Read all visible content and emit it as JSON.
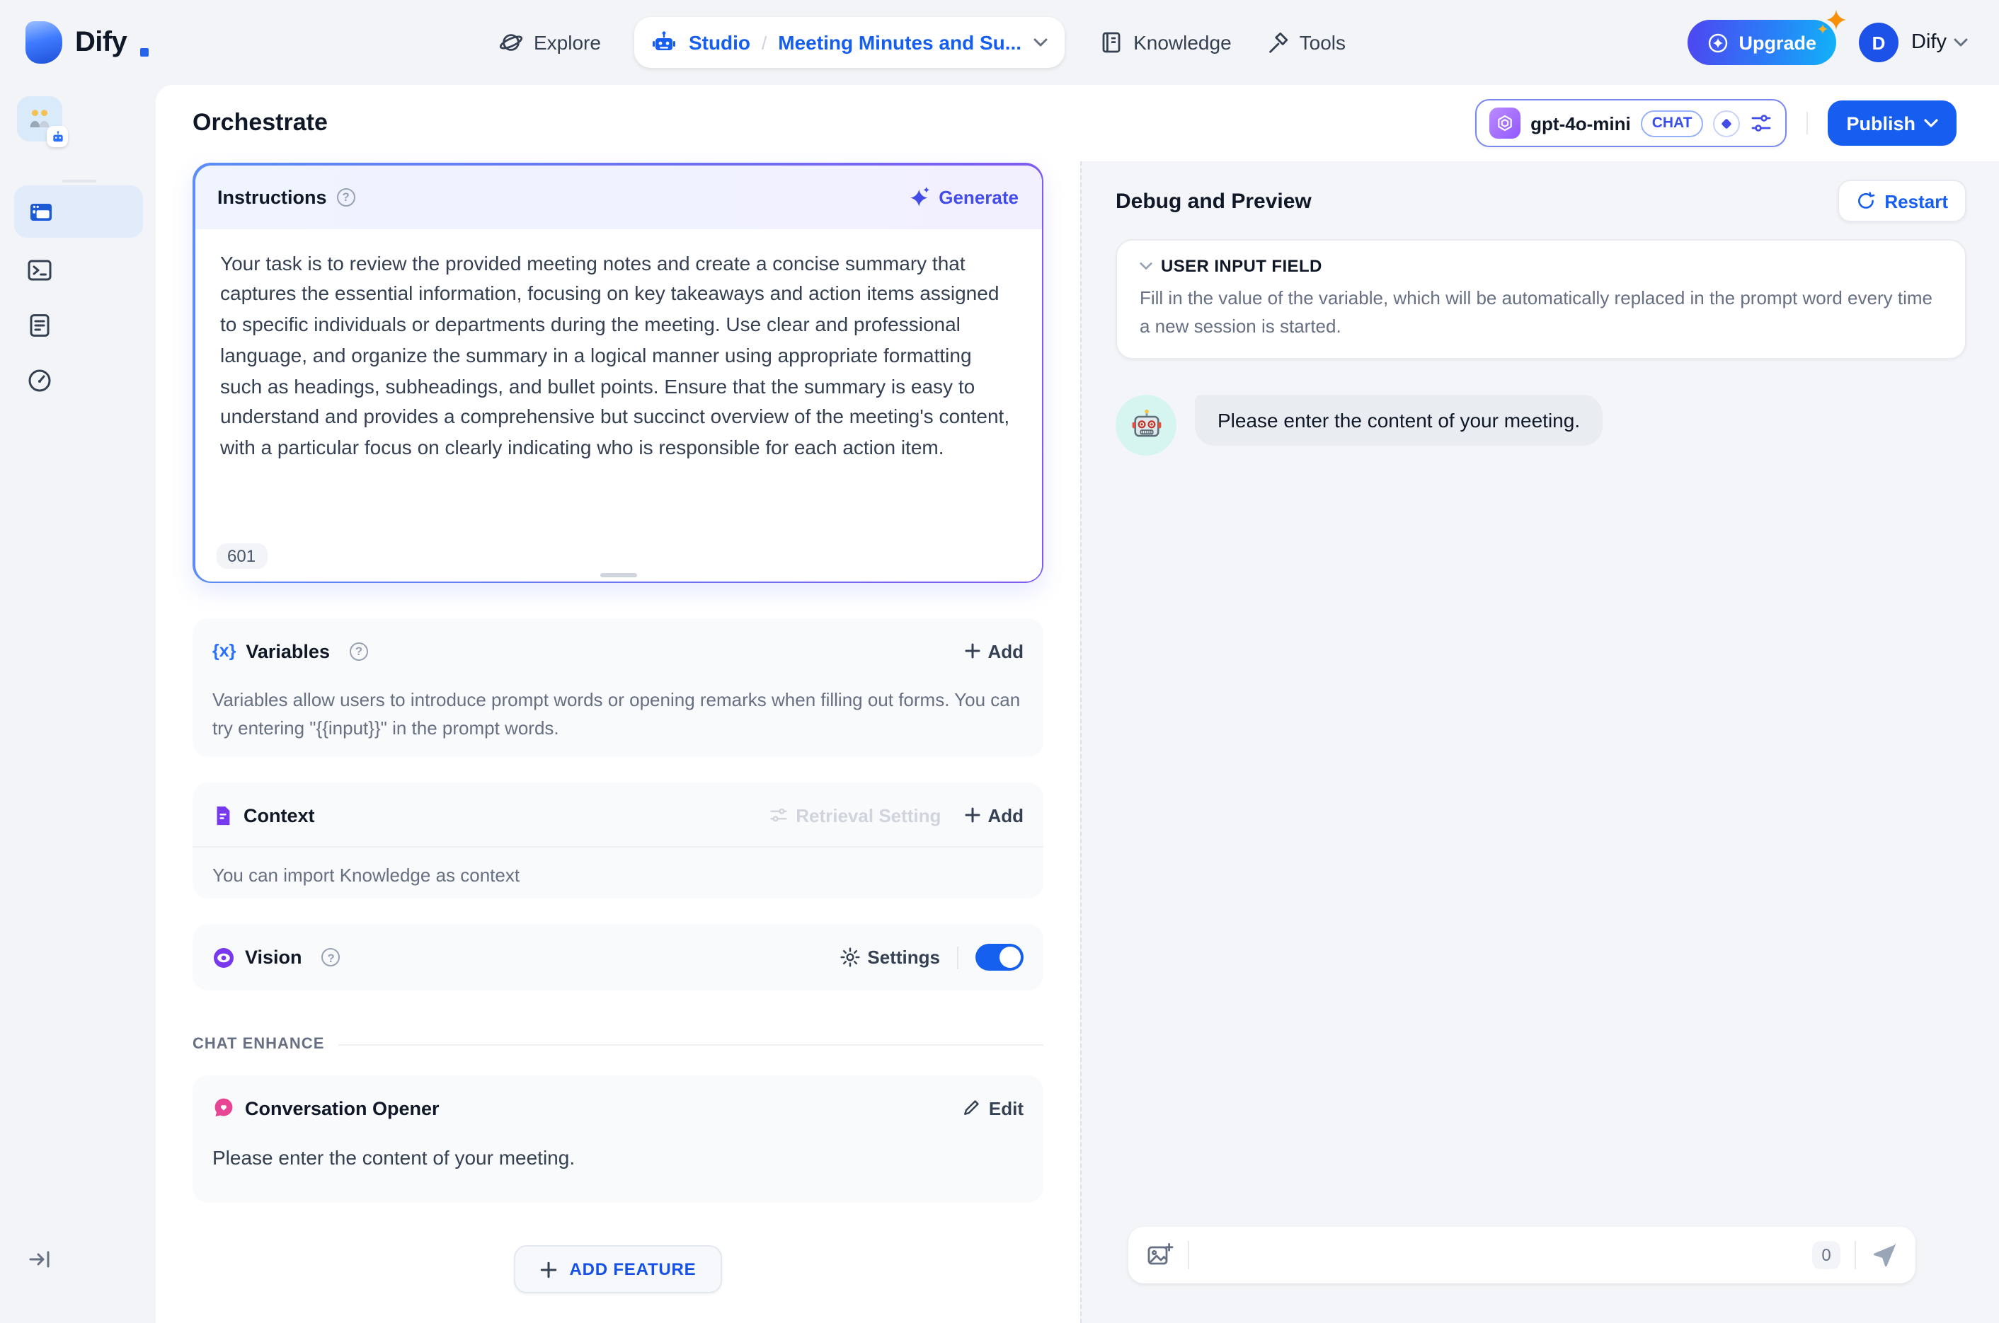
{
  "colors": {
    "primary_blue": "#155eef",
    "indigo": "#444ce7",
    "violet": "#7839ee",
    "pink": "#e74694",
    "upgrade_gradient_start": "#4e46f0",
    "upgrade_gradient_end": "#12b2f8",
    "page_background": "#f2f4f7",
    "debug_background": "#f3f5f8"
  },
  "header": {
    "logo_text": "Dify",
    "nav": {
      "explore_label": "Explore",
      "studio_label": "Studio",
      "breadcrumb_separator": "/",
      "app_name": "Meeting Minutes and Su...",
      "knowledge_label": "Knowledge",
      "tools_label": "Tools"
    },
    "upgrade_label": "Upgrade",
    "account": {
      "avatar_initial": "D",
      "name": "Dify"
    }
  },
  "toolbar": {
    "title": "Orchestrate",
    "model_selector": {
      "model_name": "gpt-4o-mini",
      "mode_badge": "CHAT"
    },
    "publish_label": "Publish"
  },
  "config": {
    "instructions": {
      "title": "Instructions",
      "generate_label": "Generate",
      "prompt_text": "Your task is to review the provided meeting notes and create a concise summary that captures the essential information, focusing on key takeaways and action items assigned to specific individuals or departments during the meeting. Use clear and professional language, and organize the summary in a logical manner using appropriate formatting such as headings, subheadings, and bullet points. Ensure that the summary is easy to understand and provides a comprehensive but succinct overview of the meeting's content, with a particular focus on clearly indicating who is responsible for each action item.",
      "char_count": "601"
    },
    "variables": {
      "type_icon_text": "{x}",
      "title": "Variables",
      "add_label": "Add",
      "description": "Variables allow users to introduce prompt words or opening remarks when filling out forms. You can try entering \"{{input}}\" in the prompt words."
    },
    "context": {
      "title": "Context",
      "retrieval_setting_label": "Retrieval Setting",
      "add_label": "Add",
      "description": "You can import Knowledge as context"
    },
    "vision": {
      "title": "Vision",
      "settings_label": "Settings",
      "enabled": true
    },
    "chat_enhance_label": "CHAT ENHANCE",
    "conversation_opener": {
      "title": "Conversation Opener",
      "edit_label": "Edit",
      "opening_text": "Please enter the content of your meeting."
    },
    "add_feature_label": "ADD FEATURE"
  },
  "debug": {
    "title": "Debug and Preview",
    "restart_label": "Restart",
    "user_input_field": {
      "title": "USER INPUT FIELD",
      "description": "Fill in the value of the variable, which will be automatically replaced in the prompt word every time a new session is started."
    },
    "bot_message": "Please enter the content of your meeting.",
    "chat_input": {
      "value": "",
      "char_count": "0"
    }
  },
  "icons": {
    "app_icon_emoji": "👬",
    "bot_avatar_emoji": "🤖"
  }
}
